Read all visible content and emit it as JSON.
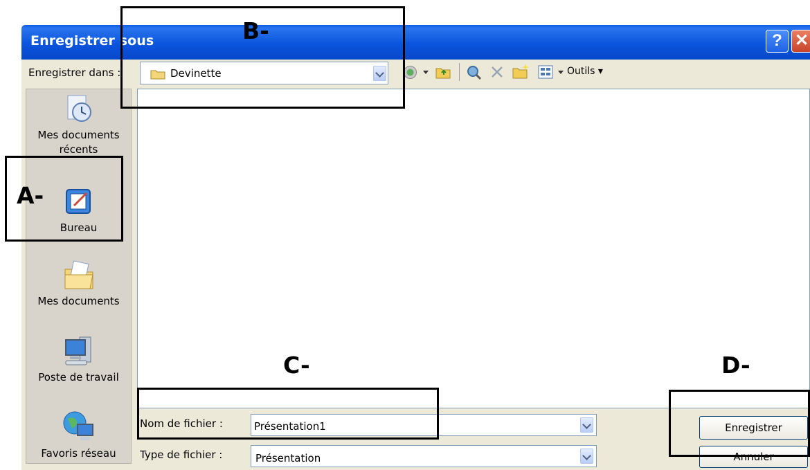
{
  "window": {
    "title": "Enregistrer sous",
    "help_label": "?",
    "close_label": "✕"
  },
  "lookin": {
    "label": "Enregistrer dans :",
    "value": "Devinette"
  },
  "toolbar": {
    "tools_label": "Outils ▾",
    "icons": [
      "back-icon",
      "up-folder-icon",
      "search-web-icon",
      "delete-icon",
      "new-folder-icon",
      "views-icon"
    ]
  },
  "places": [
    {
      "label": "Mes documents récents",
      "icon": "recent-documents-icon"
    },
    {
      "label": "Bureau",
      "icon": "desktop-icon"
    },
    {
      "label": "Mes documents",
      "icon": "my-documents-icon"
    },
    {
      "label": "Poste de travail",
      "icon": "my-computer-icon"
    },
    {
      "label": "Favoris réseau",
      "icon": "network-places-icon"
    }
  ],
  "filename": {
    "label": "Nom de fichier :",
    "value": "Présentation1"
  },
  "filetype": {
    "label": "Type de fichier :",
    "value": "Présentation"
  },
  "buttons": {
    "save": "Enregistrer",
    "cancel": "Annuler"
  },
  "annotations": {
    "a": "A-",
    "b": "B-",
    "c": "C-",
    "d": "D-"
  },
  "colors": {
    "titlebar": "#0b55de",
    "dialog_bg": "#ece9d8",
    "places_bg": "#d8d4cb",
    "field_border": "#7f9db9"
  }
}
